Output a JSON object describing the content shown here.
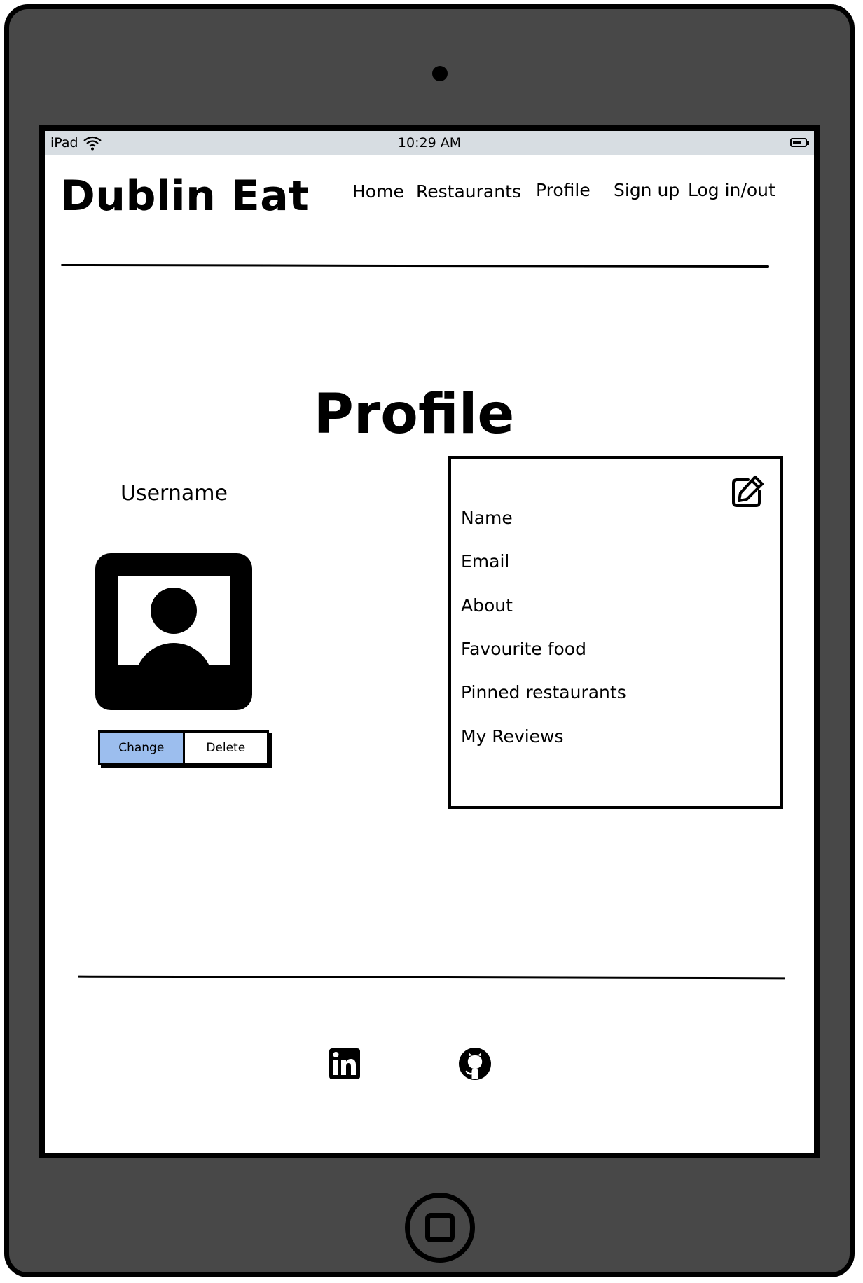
{
  "status_bar": {
    "carrier": "iPad",
    "time": "10:29 AM"
  },
  "header": {
    "brand": "Dublin Eat",
    "nav": [
      "Home",
      "Restaurants",
      "Profile",
      "Sign up",
      "Log in/out"
    ]
  },
  "main": {
    "title": "Profile",
    "username": "Username",
    "photo_buttons": {
      "change": "Change",
      "delete": "Delete"
    },
    "details": [
      "Name",
      "Email",
      "About",
      "Favourite food",
      "Pinned restaurants",
      "My Reviews"
    ]
  },
  "footer": {
    "icons": [
      "linkedin-icon",
      "github-icon"
    ]
  },
  "colors": {
    "device": "#484848",
    "status_bar": "#d7dde2",
    "change_button": "#9cbeee"
  }
}
